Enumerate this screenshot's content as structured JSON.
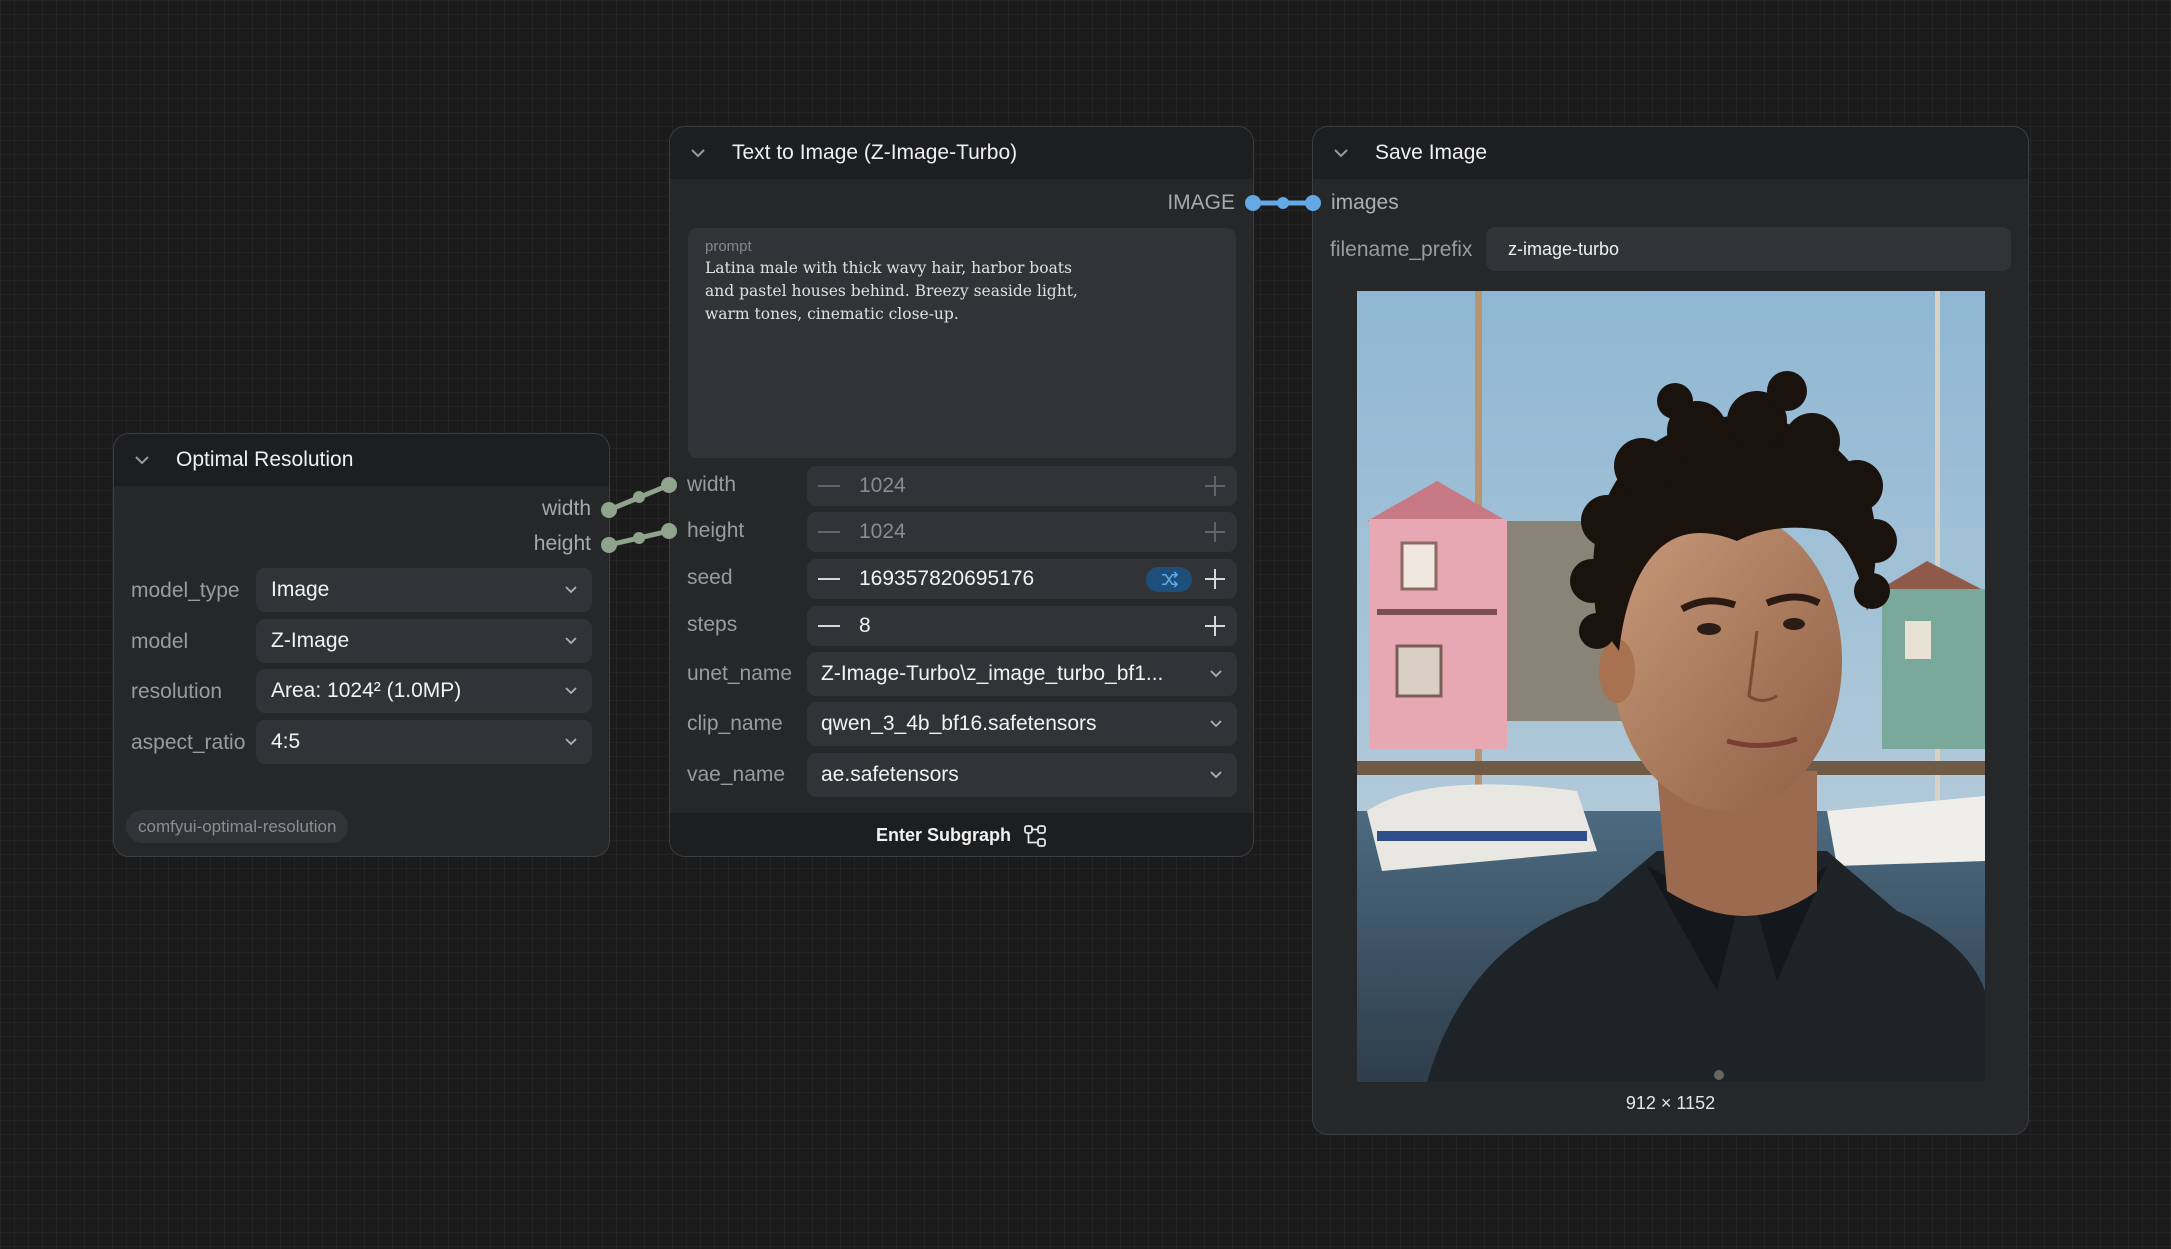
{
  "links": {
    "data_color": "#8fa38d",
    "image_color": "#64a8e6"
  },
  "optimal_resolution": {
    "title": "Optimal Resolution",
    "outputs": [
      "width",
      "height"
    ],
    "widgets": [
      {
        "label": "model_type",
        "value": "Image"
      },
      {
        "label": "model",
        "value": "Z-Image"
      },
      {
        "label": "resolution",
        "value": "Area: 1024² (1.0MP)"
      },
      {
        "label": "aspect_ratio",
        "value": "4:5"
      }
    ],
    "badge": "comfyui-optimal-resolution"
  },
  "text_to_image": {
    "title": "Text to Image (Z-Image-Turbo)",
    "output": "IMAGE",
    "prompt_label": "prompt",
    "prompt_text": "Latina male with thick wavy hair, harbor boats\nand pastel houses behind. Breezy seaside light,\nwarm tones, cinematic close-up.",
    "inputs": [
      "width",
      "height"
    ],
    "width_value": "1024",
    "height_value": "1024",
    "seed_label": "seed",
    "seed_value": "169357820695176",
    "steps_label": "steps",
    "steps_value": "8",
    "combos": [
      {
        "label": "unet_name",
        "value": "Z-Image-Turbo\\z_image_turbo_bf1..."
      },
      {
        "label": "clip_name",
        "value": "qwen_3_4b_bf16.safetensors"
      },
      {
        "label": "vae_name",
        "value": "ae.safetensors"
      }
    ],
    "footer": "Enter Subgraph"
  },
  "save_image": {
    "title": "Save Image",
    "input": "images",
    "prefix_label": "filename_prefix",
    "prefix_value": "z-image-turbo",
    "dimensions": "912 × 1152"
  }
}
